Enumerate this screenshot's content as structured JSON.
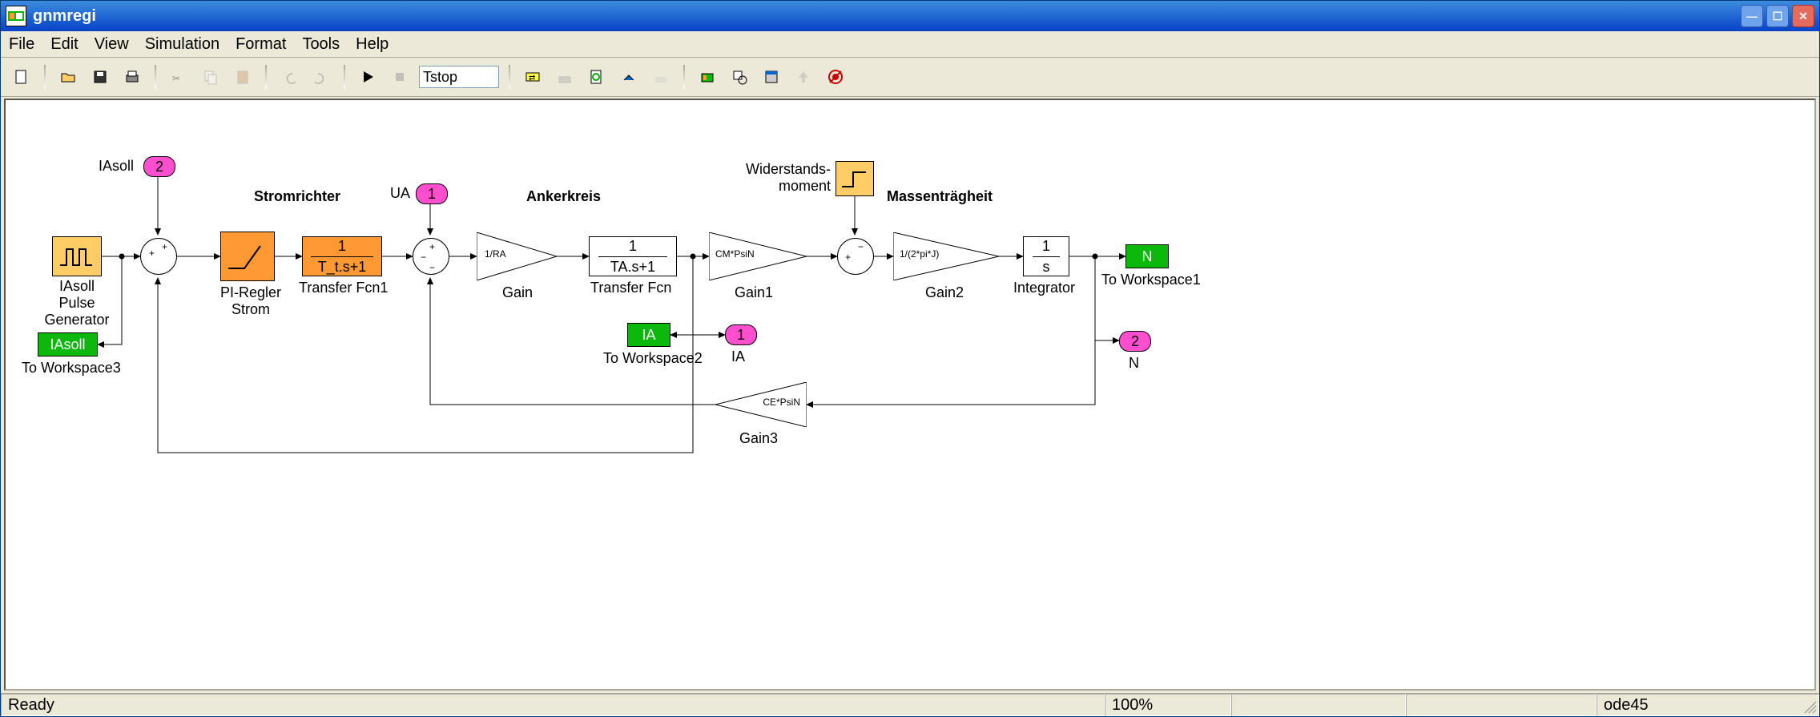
{
  "window": {
    "title": "gnmregi"
  },
  "menus": {
    "file": "File",
    "edit": "Edit",
    "view": "View",
    "simulation": "Simulation",
    "format": "Format",
    "tools": "Tools",
    "help": "Help"
  },
  "toolbar": {
    "stop_time": "Tstop"
  },
  "status": {
    "left": "Ready",
    "zoom": "100%",
    "empty1": "",
    "empty2": "",
    "solver": "ode45"
  },
  "section": {
    "stromrichter": "Stromrichter",
    "ankerkreis": "Ankerkreis",
    "massentraegheit": "Massenträgheit"
  },
  "blocks": {
    "pulse": {
      "name": "IAsoll\nPulse\nGenerator"
    },
    "inport_iasoll": {
      "value": "2",
      "annot": "IAsoll"
    },
    "sum1": {
      "signs": "++"
    },
    "pi": {
      "name": "PI-Regler\nStrom"
    },
    "tf1": {
      "num": "1",
      "den": "T_t.s+1",
      "name": "Transfer Fcn1"
    },
    "inport_ua": {
      "value": "1",
      "annot": "UA"
    },
    "sum2": {
      "signs": "+--"
    },
    "gain0": {
      "text": "1/RA",
      "name": "Gain"
    },
    "tf0": {
      "num": "1",
      "den": "TA.s+1",
      "name": "Transfer Fcn"
    },
    "gain1": {
      "text": "CM*PsiN",
      "name": "Gain1"
    },
    "widerstand": {
      "annot": "Widerstands-\nmoment"
    },
    "sum3": {
      "signs": "+-"
    },
    "gain2": {
      "text": "1/(2*pi*J)",
      "name": "Gain2"
    },
    "integrator": {
      "num": "1",
      "den": "s",
      "name": "Integrator"
    },
    "tows1": {
      "var": "N",
      "name": "To Workspace1"
    },
    "outport_n": {
      "value": "2",
      "annot": "N"
    },
    "outport_ia": {
      "value": "1",
      "annot": "IA"
    },
    "tows2": {
      "var": "IA",
      "name": "To Workspace2"
    },
    "gain3": {
      "text": "CE*PsiN",
      "name": "Gain3"
    },
    "tows3": {
      "var": "IAsoll",
      "name": "To Workspace3"
    }
  }
}
